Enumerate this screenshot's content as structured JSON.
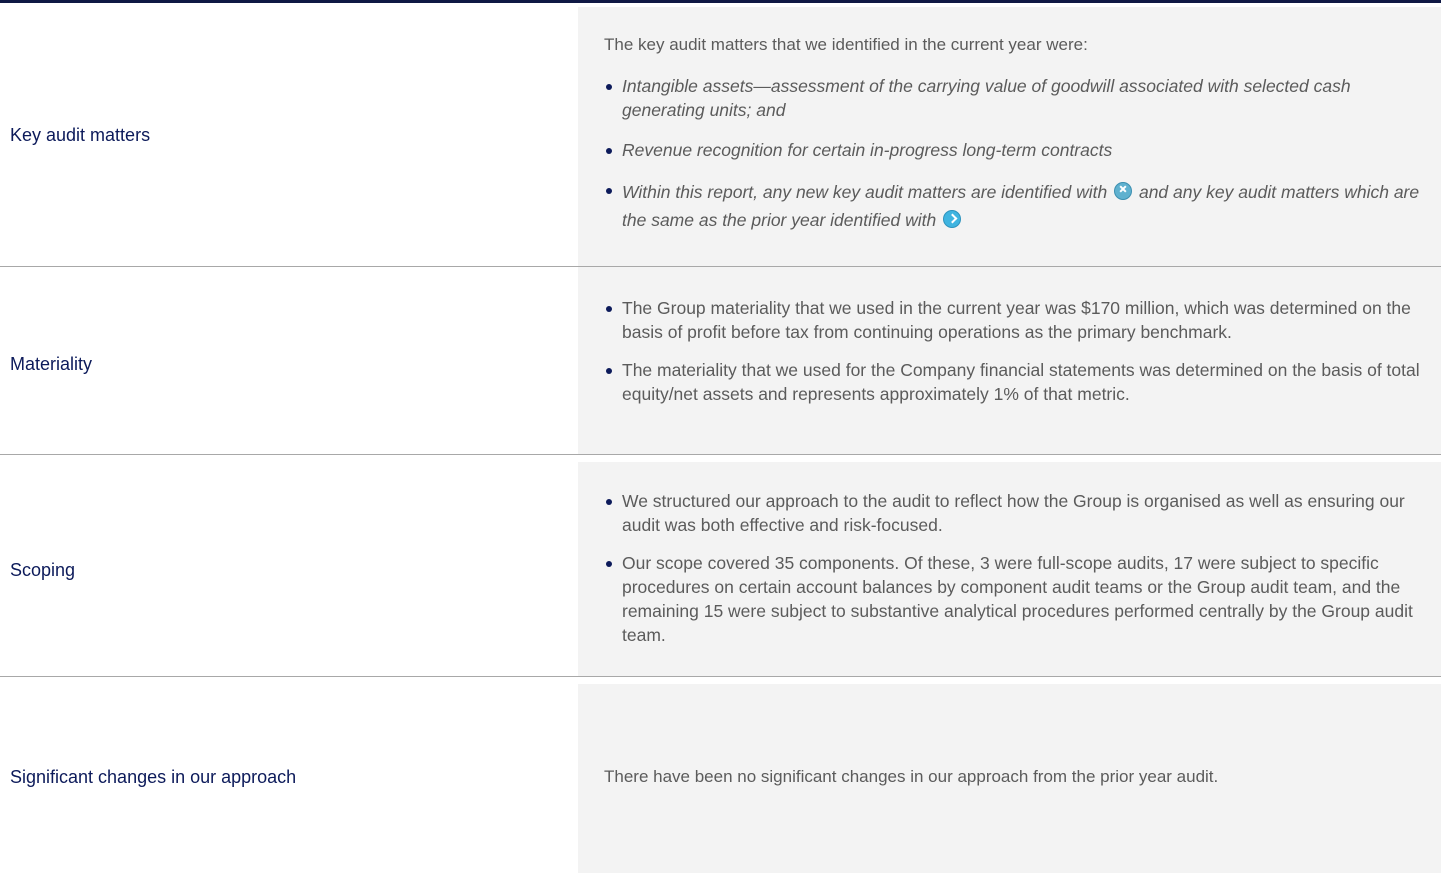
{
  "rows": [
    {
      "label": "Key audit matters",
      "intro": "The key audit matters that we identified in the current year were:",
      "bullets": [
        "Intangible assets—assessment of the carrying value of goodwill associated with selected cash generating units; and",
        "Revenue recognition for certain in-progress long-term contracts",
        "Within this report, any new key audit matters are identified with",
        "and any key audit matters which are the same as the prior year identified with"
      ]
    },
    {
      "label": "Materiality",
      "bullets": [
        "The Group materiality that we used in the current year was $170 million, which was determined on the basis of profit before tax from continuing operations as the primary benchmark.",
        "The materiality that we used for the Company financial statements was determined on the basis of total equity/net assets and represents approximately 1% of that metric."
      ]
    },
    {
      "label": "Scoping",
      "bullets": [
        "We structured our approach to the audit to reflect how the Group is organised as well as ensuring our audit was both effective and risk-focused.",
        "Our scope covered 35 components. Of these, 3 were full-scope audits, 17 were subject to specific procedures on certain account balances by component audit teams or the Group audit team, and the remaining 15 were subject to substantive analytical procedures performed centrally by the Group audit team."
      ]
    },
    {
      "label": "Significant changes in our approach",
      "text": "There have been no significant changes in our approach from the prior year audit."
    }
  ],
  "icons": {
    "new_marker": "new-key-audit-matter-icon",
    "same_marker": "same-key-audit-matter-icon"
  },
  "colors": {
    "label_text": "#0c1a5a",
    "body_text": "#5b5b5b",
    "panel_bg": "#f3f3f3",
    "top_rule": "#0f1844"
  }
}
